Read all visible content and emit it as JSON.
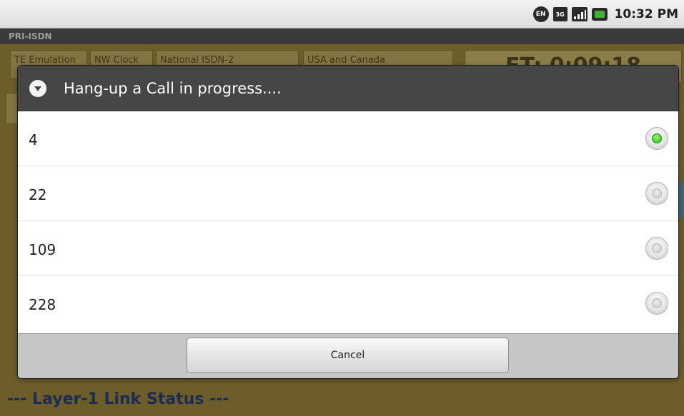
{
  "status_bar": {
    "keyboard_lang": "EN",
    "network_type": "3G",
    "icons": [
      "en-keyboard-icon",
      "3g-icon",
      "signal-icon",
      "battery-icon"
    ],
    "time": "10:32 PM"
  },
  "app": {
    "title": "PRI-ISDN",
    "toolbar_tabs": [
      "TE Emulation",
      "NW Clock",
      "National ISDN-2",
      "USA and Canada"
    ],
    "elapsed_time": "ET: 0:09:18",
    "layer_status": "--- Layer-1 Link Status ---",
    "colors": {
      "background": "#6d5d2a",
      "status_text": "#1c2a56"
    }
  },
  "dialog": {
    "title": "Hang-up a Call in progress....",
    "icon": "chevron-down-circle-icon",
    "options": [
      {
        "label": "4",
        "selected": true
      },
      {
        "label": "22",
        "selected": false
      },
      {
        "label": "109",
        "selected": false
      },
      {
        "label": "228",
        "selected": false
      }
    ],
    "cancel_label": "Cancel",
    "colors": {
      "header_bg": "#464646",
      "selected_radio": "#1fbf1a",
      "footer_bg": "#c6c6c6"
    }
  }
}
